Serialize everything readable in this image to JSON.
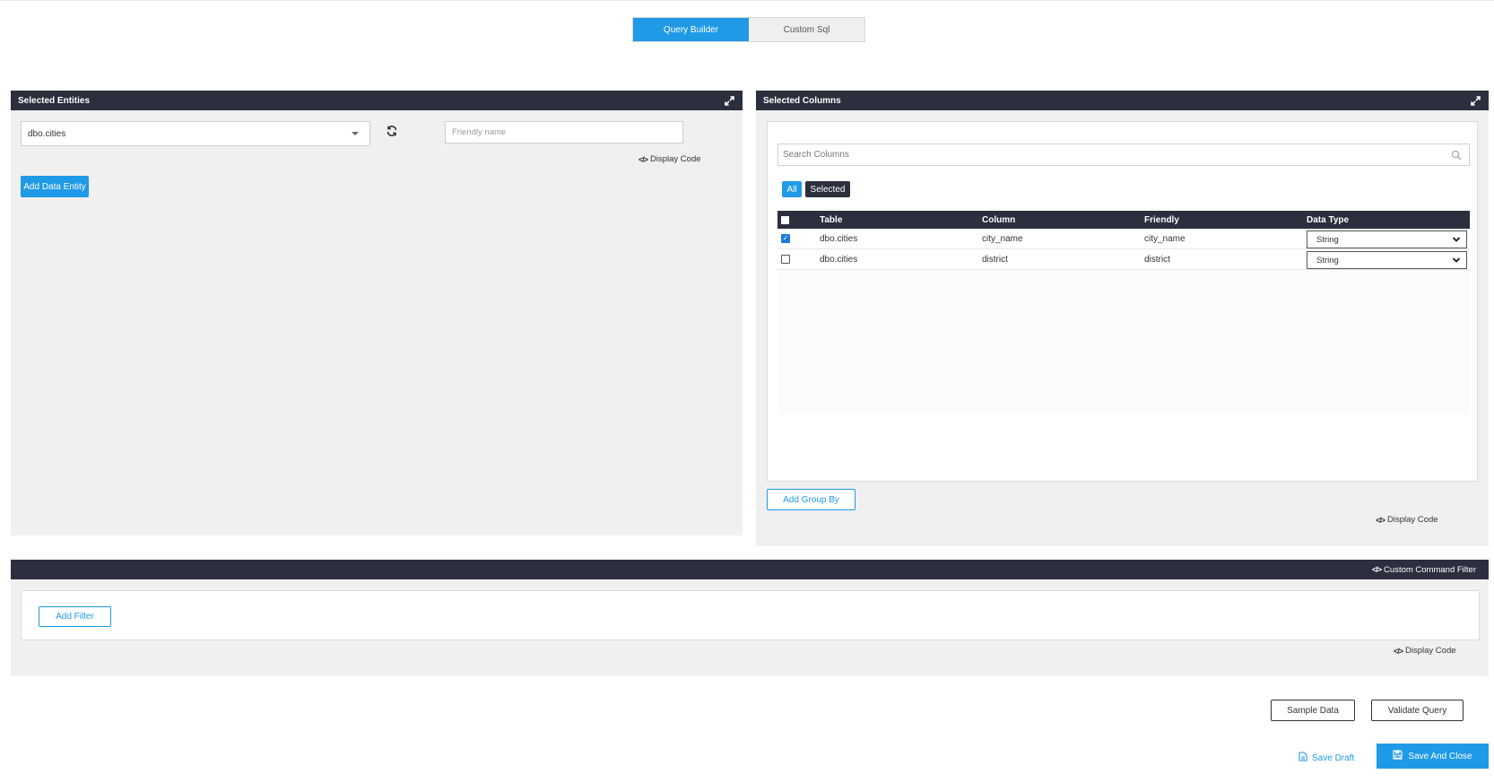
{
  "mode_toggle": {
    "query_builder": "Query Builder",
    "custom_sql": "Custom Sql"
  },
  "entities_panel": {
    "title": "Selected Entities",
    "entity_select_value": "dbo.cities",
    "friendly_placeholder": "Friendly name",
    "display_code": "Display Code",
    "add_entity_label": "Add Data Entity"
  },
  "columns_panel": {
    "title": "Selected Columns",
    "search_placeholder": "Search Columns",
    "filter_all": "All",
    "filter_selected": "Selected",
    "headers": {
      "table": "Table",
      "column": "Column",
      "friendly": "Friendly",
      "data_type": "Data Type"
    },
    "rows": [
      {
        "checked": true,
        "table": "dbo.cities",
        "column": "city_name",
        "friendly": "city_name",
        "data_type": "String"
      },
      {
        "checked": false,
        "table": "dbo.cities",
        "column": "district",
        "friendly": "district",
        "data_type": "String"
      }
    ],
    "add_group_by": "Add Group By",
    "display_code": "Display Code"
  },
  "filter_panel": {
    "custom_command_filter": "Custom Command Filter",
    "add_filter": "Add Filter",
    "display_code": "Display Code"
  },
  "footer": {
    "sample_data": "Sample Data",
    "validate_query": "Validate Query",
    "save_draft": "Save Draft",
    "save_and_close": "Save And Close"
  },
  "colors": {
    "accent": "#1f9ae6",
    "header_dark": "#2b2f3e",
    "panel_bg": "#f0f0f0"
  }
}
